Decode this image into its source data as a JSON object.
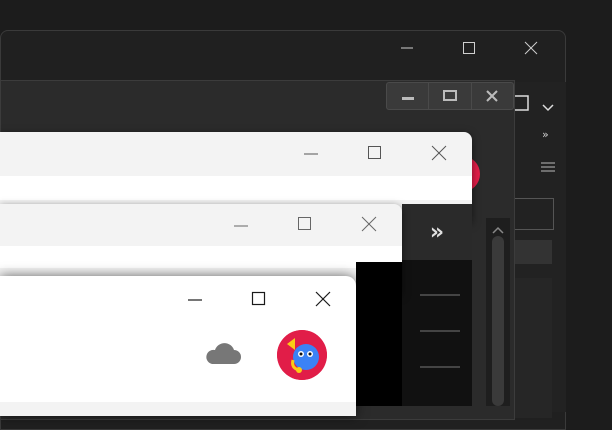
{
  "outer_window": {
    "controls": [
      "minimize",
      "maximize",
      "close"
    ],
    "right_panel": {
      "chevron_label": "»",
      "menu_icon": "menu-icon"
    }
  },
  "middle_window": {
    "toolbar_buttons": [
      "minimize",
      "restore",
      "close"
    ]
  },
  "window_light_1": {
    "controls": [
      "minimize",
      "maximize",
      "close"
    ]
  },
  "window_light_2": {
    "controls": [
      "minimize",
      "maximize",
      "close"
    ],
    "overflow_label": "»"
  },
  "front_window": {
    "controls": [
      "minimize",
      "maximize",
      "close"
    ],
    "icons": [
      "cloud-icon",
      "avatar"
    ]
  },
  "colors": {
    "accent": "#e11d48",
    "light_bg": "#f3f3f3",
    "dark_bg": "#202020"
  }
}
